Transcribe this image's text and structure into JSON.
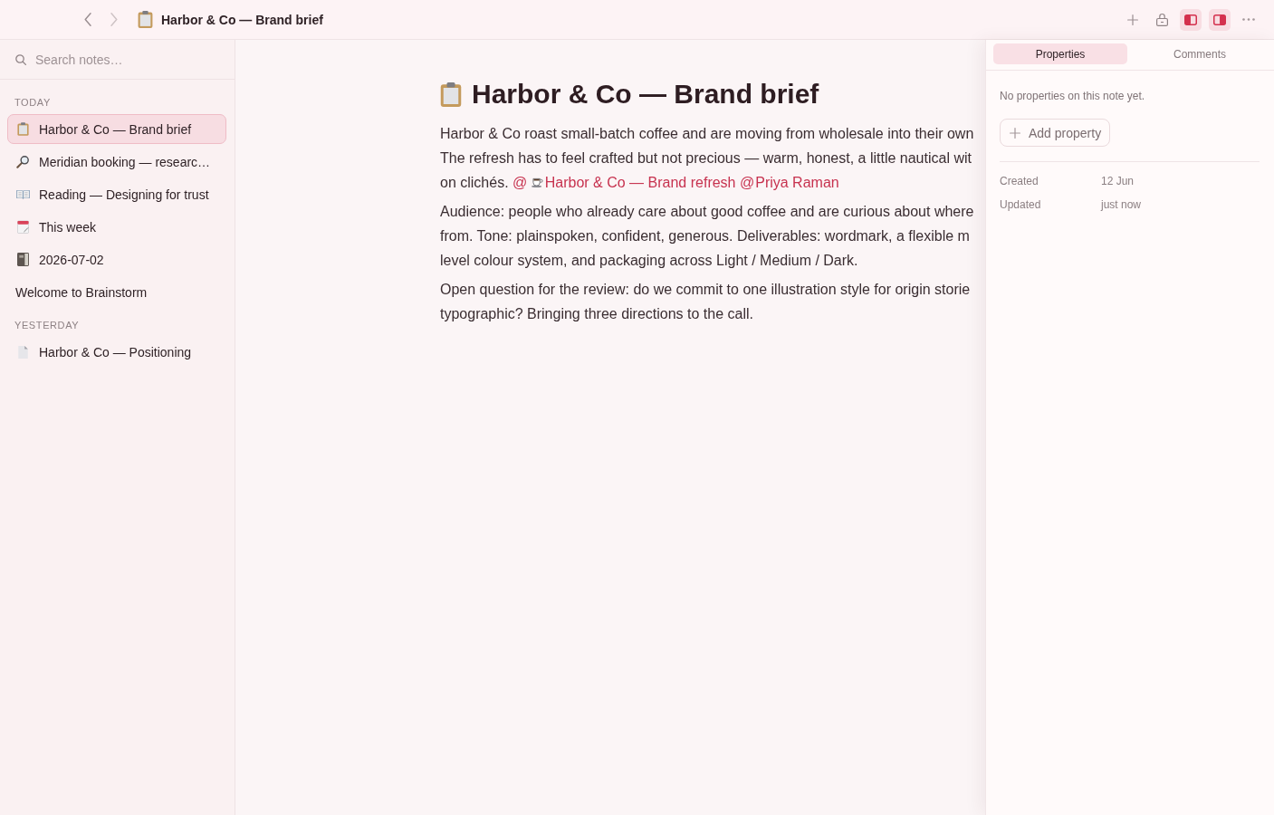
{
  "topbar": {
    "navigation": {
      "back": {
        "disabled": false
      },
      "forward": {
        "disabled": true
      }
    },
    "title": "Harbor & Co — Brand brief",
    "toggles": {
      "left_panel": {
        "on": true
      },
      "right_panel": {
        "on": true
      }
    }
  },
  "sidebar": {
    "search": {
      "placeholder": "Search notes…"
    },
    "sections": [
      {
        "title": "TODAY",
        "items": [
          {
            "kind": "clipboard",
            "label": "Harbor & Co — Brand brief",
            "selected": true
          },
          {
            "kind": "magnifier",
            "label": "Meridian booking — researc…",
            "selected": false
          },
          {
            "kind": "book",
            "label": "Reading — Designing for trust",
            "selected": false
          },
          {
            "kind": "calendar",
            "label": "This week",
            "selected": false
          },
          {
            "kind": "notebook",
            "label": "2026-07-02",
            "selected": false
          },
          {
            "kind": "plain",
            "label": "Welcome to Brainstorm",
            "selected": false
          }
        ]
      },
      {
        "title": "YESTERDAY",
        "items": [
          {
            "kind": "page",
            "label": "Harbor & Co — Positioning",
            "selected": false
          }
        ]
      }
    ]
  },
  "document": {
    "title": "Harbor & Co — Brand brief",
    "paragraphs": [
      {
        "lines": [
          "Harbor & Co roast small-batch coffee and are moving from wholesale into their own",
          "The refresh has to feel crafted but not precious — warm, honest, a little nautical wit",
          "on clichés."
        ],
        "mentions": [
          {
            "kind": "page",
            "sigil": "@",
            "label": "Harbor & Co — Brand refresh"
          },
          {
            "kind": "person",
            "sigil": "@",
            "label": "Priya Raman"
          }
        ]
      },
      {
        "lines": [
          "Audience: people who already care about good coffee and are curious about where",
          "from. Tone: plainspoken, confident, generous. Deliverables: wordmark, a flexible m",
          "level colour system, and packaging across Light / Medium / Dark."
        ]
      },
      {
        "lines": [
          "Open question for the review: do we commit to one illustration style for origin storie",
          "typographic? Bringing three directions to the call."
        ]
      }
    ]
  },
  "inspector": {
    "tabs": [
      {
        "label": "Properties",
        "selected": true
      },
      {
        "label": "Comments",
        "selected": false
      }
    ],
    "empty_message": "No properties on this note yet.",
    "add_button": "Add property",
    "meta": [
      {
        "label": "Created",
        "value": "12 Jun"
      },
      {
        "label": "Updated",
        "value": "just now"
      }
    ]
  }
}
